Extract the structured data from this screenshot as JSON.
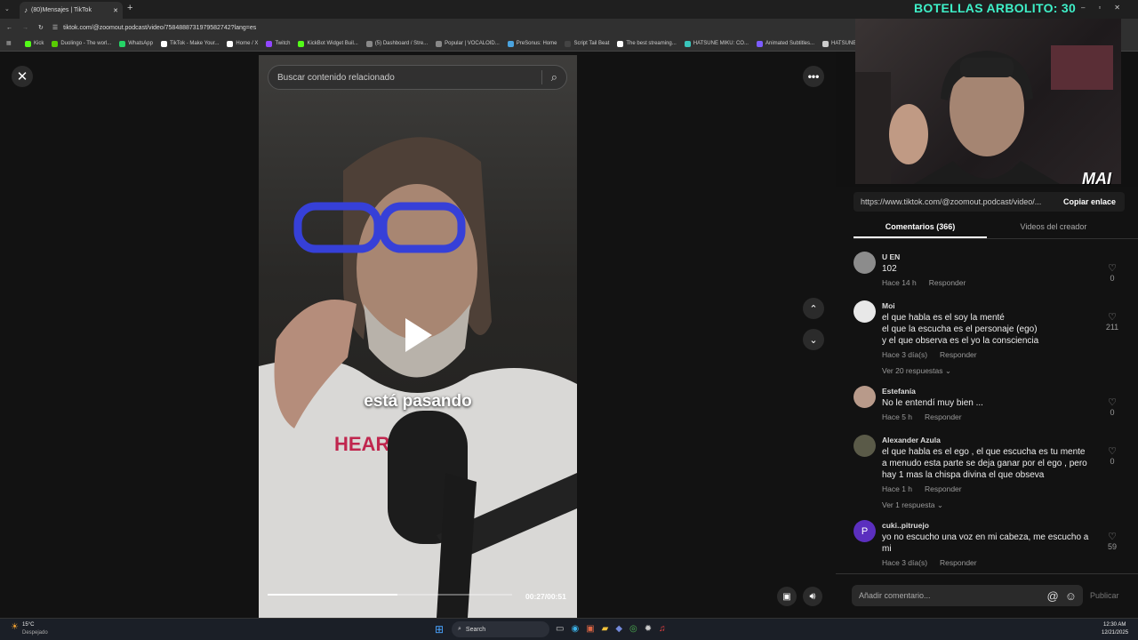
{
  "browser": {
    "tab_title": "(80)Mensajes | TikTok",
    "url": "tiktok.com/@zoomout.podcast/video/7584888731979582742?lang=es",
    "bookmarks": [
      {
        "label": "Kick",
        "color": "#53fc18"
      },
      {
        "label": "Duolingo - The worl...",
        "color": "#58cc02"
      },
      {
        "label": "WhatsApp",
        "color": "#25d366"
      },
      {
        "label": "TikTok - Make Your...",
        "color": "#fff"
      },
      {
        "label": "Home / X",
        "color": "#fff"
      },
      {
        "label": "Twitch",
        "color": "#9146ff"
      },
      {
        "label": "KickBot Widget Buil...",
        "color": "#53fc18"
      },
      {
        "label": "(5) Dashboard / Stre...",
        "color": "#888"
      },
      {
        "label": "Popular | VOCALOID...",
        "color": "#888"
      },
      {
        "label": "PreSonus: Home",
        "color": "#4aa3df"
      },
      {
        "label": "Script Tail Beat",
        "color": "#444"
      },
      {
        "label": "The best streaming...",
        "color": "#fff"
      },
      {
        "label": "HATSUNE MIKU: CO...",
        "color": "#39c5bb"
      },
      {
        "label": "Animated Subtitles...",
        "color": "#7c5cff"
      },
      {
        "label": "HATSUNE M",
        "color": "#ccc"
      }
    ]
  },
  "overlay": {
    "counter": "BOTELLAS ARBOLITO: 30",
    "counter_color": "#3ef0c8",
    "watermark": "MAI"
  },
  "video": {
    "search_placeholder": "Buscar contenido relacionado",
    "caption": "está pasando",
    "time": "00:27/00:51",
    "progress": 0.53
  },
  "panel": {
    "link": "https://www.tiktok.com/@zoomout.podcast/video/...",
    "copy_label": "Copiar enlace",
    "tabs": [
      "Comentarios (366)",
      "Videos del creador"
    ],
    "reply_label": "Responder",
    "comments": [
      {
        "user": "U EN",
        "lines": [
          "102"
        ],
        "time": "Hace 14 h",
        "likes": "0",
        "avatar": "#8c8c8c"
      },
      {
        "user": "Moi",
        "lines": [
          "el que habla es el soy la menté",
          "el que la escucha es el personaje (ego)",
          "y el que observa es el yo la consciencia"
        ],
        "time": "Hace 3 día(s)",
        "likes": "211",
        "more": "Ver 20 respuestas",
        "avatar": "#e8e8e8"
      },
      {
        "user": "Estefanía",
        "lines": [
          "No le entendí muy bien ..."
        ],
        "time": "Hace 5 h",
        "likes": "0",
        "avatar": "#b89a8a"
      },
      {
        "user": "Alexander Azula",
        "lines": [
          "el que habla es el ego , el que escucha es tu mente",
          "a menudo esta parte se deja ganar por el ego , pero",
          "hay 1 mas la chispa divina el que obseva"
        ],
        "time": "Hace 1 h",
        "likes": "0",
        "more": "Ver 1 respuesta",
        "avatar": "#5a5a48"
      },
      {
        "user": "cuki..pitruejo",
        "lines": [
          "yo no escucho una voz en mi cabeza, me escucho a",
          "mi"
        ],
        "time": "Hace 3 día(s)",
        "likes": "59",
        "avatar": "#5b2fbf",
        "initial": "P"
      }
    ],
    "comment_placeholder": "Añadir comentario...",
    "publish": "Publicar"
  },
  "taskbar": {
    "temp": "15°C",
    "weather": "Despejado",
    "search": "Search",
    "time": "12:30 AM",
    "date": "12/21/2025"
  }
}
